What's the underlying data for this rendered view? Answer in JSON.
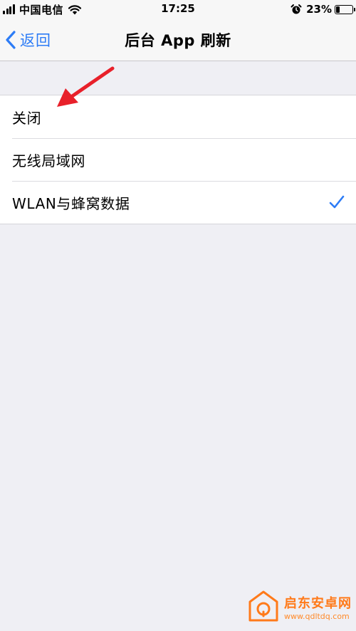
{
  "status_bar": {
    "carrier": "中国电信",
    "time": "17:25",
    "battery": "23%",
    "battery_level": 0.23,
    "icons": [
      "signal-icon",
      "wifi-icon",
      "alarm-icon",
      "battery-icon"
    ]
  },
  "nav": {
    "back_label": "返回",
    "title": "后台 App 刷新"
  },
  "options": [
    {
      "label": "关闭",
      "selected": false
    },
    {
      "label": "无线局域网",
      "selected": false
    },
    {
      "label": "WLAN与蜂窝数据",
      "selected": true
    }
  ],
  "colors": {
    "accent": "#2d7cf6",
    "annotation": "#e8202a",
    "background": "#efeff4"
  },
  "watermark": {
    "name": "启东安卓网",
    "url": "www.qdltdq.com"
  }
}
